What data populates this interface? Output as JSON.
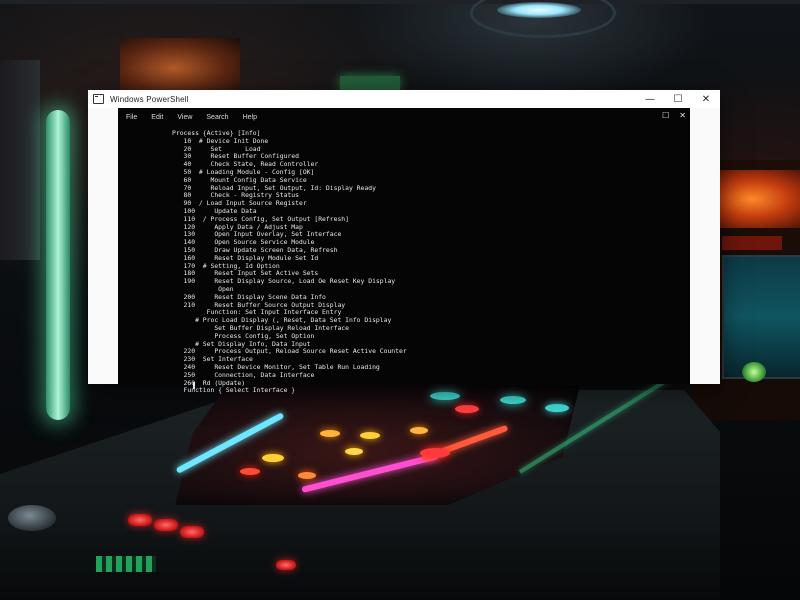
{
  "window": {
    "title": "Windows PowerShell",
    "minimize_glyph": "—",
    "maximize_glyph": "☐",
    "close_glyph": "✕"
  },
  "menubar": {
    "items": [
      "File",
      "Edit",
      "View",
      "Search",
      "Help"
    ],
    "restore_glyph": "☐",
    "close_glyph": "✕"
  },
  "terminal": {
    "lines": [
      "Process {Active} [Info]",
      "   10  # Device Init Done",
      "   20     Set      Load",
      "   30     Reset Buffer Configured",
      "   40     Check State, Read Controller",
      "   50  # Loading Module - Config [OK]",
      "   60     Mount Config Data Service",
      "   70     Reload Input, Set Output, Id: Display Ready",
      "   80     Check - Registry Status",
      "   90  / Load Input Source Register",
      "   100     Update Data",
      "   110  / Process Config, Set Output [Refresh]",
      "   120     Apply Data / Adjust Map",
      "   130     Open Input Overlay, Set Interface",
      "   140     Open Source Service Module",
      "   150     Draw Update Screen Data, Refresh",
      "   160     Reset Display Module Set Id",
      "   170  # Setting, Id Option",
      "   180     Reset Input Set Active Sets",
      "   190     Reset Display Source, Load Oe Reset Key Display",
      "            Open",
      "   200     Reset Display Scene Data Info",
      "   210     Reset Buffer Source Output Display",
      "         Function: Set Input Interface Entry",
      "      # Proc Load Display (, Reset, Data Set Info Display",
      "           Set Buffer Display Reload Interface",
      "           Process Config, Set Option",
      "      # Set Display Info, Data Input",
      "   220     Process Output, Reload Source Reset Active Counter",
      "   230  Set Interface",
      "   240     Reset Device Monitor, Set Table Run Loading",
      "   250     Connection, Data Interface",
      "   260  Rd (Update)",
      "   Function { Select Interface }",
      ""
    ]
  }
}
